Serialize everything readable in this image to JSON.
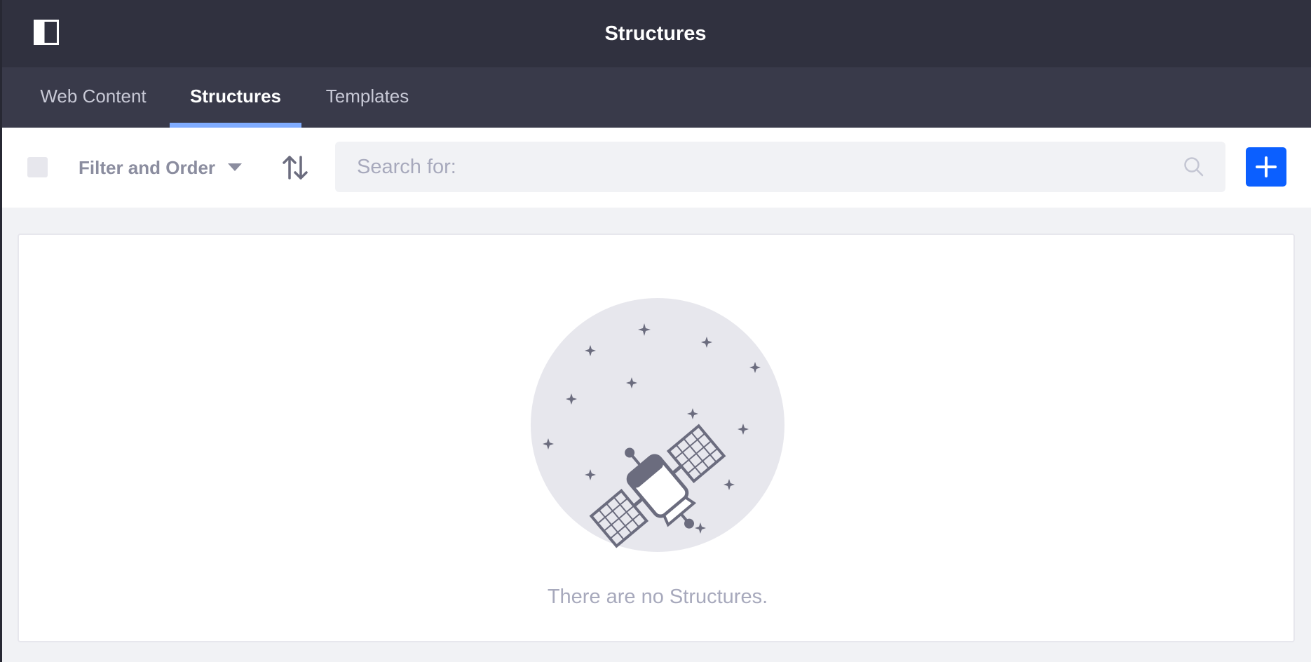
{
  "header": {
    "title": "Structures",
    "panel_toggle_icon": "product-menu-toggle-icon"
  },
  "tabs": [
    {
      "label": "Web Content",
      "active": false
    },
    {
      "label": "Structures",
      "active": true
    },
    {
      "label": "Templates",
      "active": false
    }
  ],
  "toolbar": {
    "filter_label": "Filter and Order",
    "sort_icon": "order-arrow-icon",
    "search_placeholder": "Search for:",
    "search_value": "",
    "add_icon": "plus-icon"
  },
  "empty_state": {
    "illustration": "satellite-illustration",
    "message": "There are no Structures."
  },
  "colors": {
    "header_bg": "#30313f",
    "tab_bar_bg": "#393a4a",
    "tab_indicator": "#80acff",
    "primary": "#0b5fff",
    "muted_text": "#a7a9bc",
    "page_bg": "#f1f2f5"
  }
}
